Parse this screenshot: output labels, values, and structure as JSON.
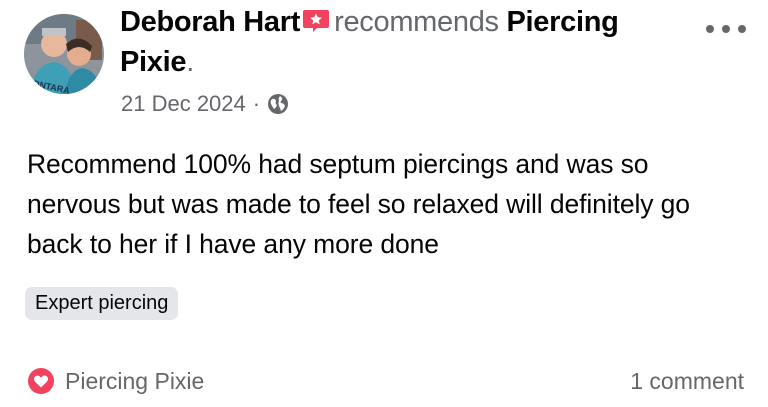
{
  "post": {
    "author": "Deborah Hart",
    "action": "recommends",
    "page_name": "Piercing Pixie",
    "date": "21 Dec 2024",
    "separator": "·",
    "body": "Recommend 100% had septum piercings and was so nervous but was made to feel so relaxed will definitely go back to her if I have any more done",
    "tag": "Expert piercing"
  },
  "footer": {
    "page_link": "Piercing Pixie",
    "comments": "1 comment"
  },
  "icons": {
    "badge": "star-badge-icon",
    "audience": "globe-icon",
    "recommend": "heart-icon",
    "menu": "more-options-icon"
  },
  "colors": {
    "text": "#050505",
    "secondary": "#65676b",
    "badge": "#f3425f",
    "tag_bg": "#e4e6eb"
  }
}
